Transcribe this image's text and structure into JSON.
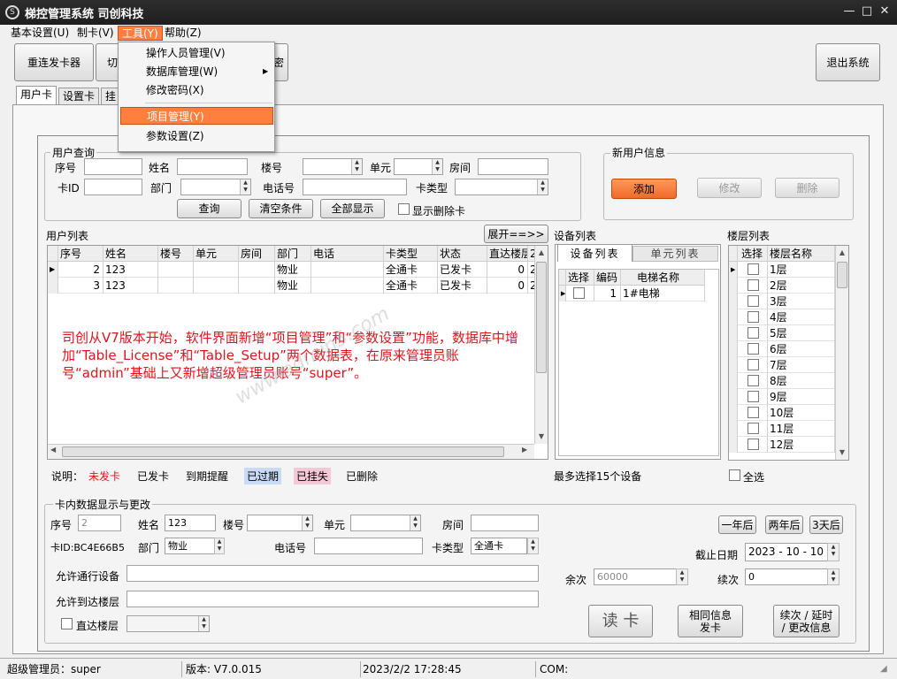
{
  "window": {
    "title": "梯控管理系统  司创科技"
  },
  "menubar": [
    {
      "label": "基本设置(U)"
    },
    {
      "label": "制卡(V)"
    },
    {
      "label": "工具(Y)"
    },
    {
      "label": "帮助(Z)"
    }
  ],
  "tools_menu": [
    {
      "label": "操作人员管理(V)"
    },
    {
      "label": "数据库管理(W)"
    },
    {
      "label": "修改密码(X)"
    },
    {
      "label": "项目管理(Y)"
    },
    {
      "label": "参数设置(Z)"
    }
  ],
  "toolbar": {
    "reconnect_label": "重连发卡器",
    "switch_label": "切",
    "partial_label": "密",
    "exit_label": "退出系统"
  },
  "tabs": [
    {
      "label": "用户卡"
    },
    {
      "label": "设置卡"
    },
    {
      "label": "挂"
    }
  ],
  "query": {
    "group_title": "用户查询",
    "seq_label": "序号",
    "name_label": "姓名",
    "building_label": "楼号",
    "unit_label": "单元",
    "room_label": "房间",
    "cardid_label": "卡ID",
    "dept_label": "部门",
    "phone_label": "电话号",
    "cardtype_label": "卡类型",
    "query_btn": "查询",
    "clear_btn": "清空条件",
    "showall_btn": "全部显示",
    "show_deleted_label": "显示删除卡"
  },
  "newuser": {
    "group_title": "新用户信息",
    "add_btn": "添加",
    "modify_btn": "修改",
    "delete_btn": "删除"
  },
  "userlist": {
    "title": "用户列表",
    "expand_btn": "展开==>>",
    "columns": [
      "序号",
      "姓名",
      "楼号",
      "单元",
      "房间",
      "部门",
      "电话",
      "卡类型",
      "状态",
      "直达楼层",
      "2"
    ],
    "rows": [
      {
        "seq": "2",
        "name": "123",
        "dept": "物业",
        "type": "全通卡",
        "status": "已发卡",
        "direct": "0",
        "extra": "2"
      },
      {
        "seq": "3",
        "name": "123",
        "dept": "物业",
        "type": "全通卡",
        "status": "已发卡",
        "direct": "0",
        "extra": "2"
      }
    ]
  },
  "notice": "司创从V7版本开始，软件界面新增“项目管理”和“参数设置”功能，数据库中增加“Table_License”和“Table_Setup”两个数据表，在原来管理员账号“admin”基础上又新增超级管理员账号“super”。",
  "watermark": "www.admin5.com",
  "devices": {
    "title": "设备列表",
    "tab_devices": "设备列表",
    "tab_units": "单元列表",
    "col_select": "选择",
    "col_code": "编码",
    "col_name": "电梯名称",
    "rows": [
      {
        "code": "1",
        "name": "1#电梯"
      }
    ],
    "hint": "最多选择15个设备"
  },
  "floors": {
    "title": "楼层列表",
    "col_select": "选择",
    "col_name": "楼层名称",
    "rows": [
      "1层",
      "2层",
      "3层",
      "4层",
      "5层",
      "6层",
      "7层",
      "8层",
      "9层",
      "10层",
      "11层",
      "12层"
    ],
    "select_all": "全选"
  },
  "legend": {
    "prefix": "说明：",
    "items": [
      {
        "label": "未发卡",
        "color": "#e0141e",
        "bg": ""
      },
      {
        "label": "已发卡",
        "color": "#000000",
        "bg": ""
      },
      {
        "label": "到期提醒",
        "color": "#000000",
        "bg": ""
      },
      {
        "label": "已过期",
        "color": "#000000",
        "bg": "#c8daf5"
      },
      {
        "label": "已挂失",
        "color": "#000000",
        "bg": "#f5c8d8"
      },
      {
        "label": "已删除",
        "color": "#000000",
        "bg": ""
      }
    ]
  },
  "carddata": {
    "group_title": "卡内数据显示与更改",
    "seq_label": "序号",
    "seq_value": "2",
    "name_label": "姓名",
    "name_value": "123",
    "building_label": "楼号",
    "unit_label": "单元",
    "room_label": "房间",
    "cardid_label": "卡ID:BC4E66B5",
    "dept_label": "部门",
    "dept_value": "物业",
    "phone_label": "电话号",
    "cardtype_label": "卡类型",
    "cardtype_value": "全通卡",
    "allowed_devices_label": "允许通行设备",
    "allowed_floors_label": "允许到达楼层",
    "direct_floor_label": "直达楼层",
    "one_year": "一年后",
    "two_year": "两年后",
    "three_days": "3天后",
    "expiry_label": "截止日期",
    "expiry_value": "2023 - 10 - 10",
    "remaining_label": "余次",
    "remaining_value": "60000",
    "renew_label": "续次",
    "renew_value": "0",
    "read_btn": "读 卡",
    "same_btn": "相同信息\n发卡",
    "renew_btn": "续次 / 延时\n/ 更改信息"
  },
  "status": {
    "user": "超级管理员：super",
    "version": "版本: V7.0.015",
    "datetime": "2023/2/2 17:28:45",
    "com": "COM:"
  }
}
